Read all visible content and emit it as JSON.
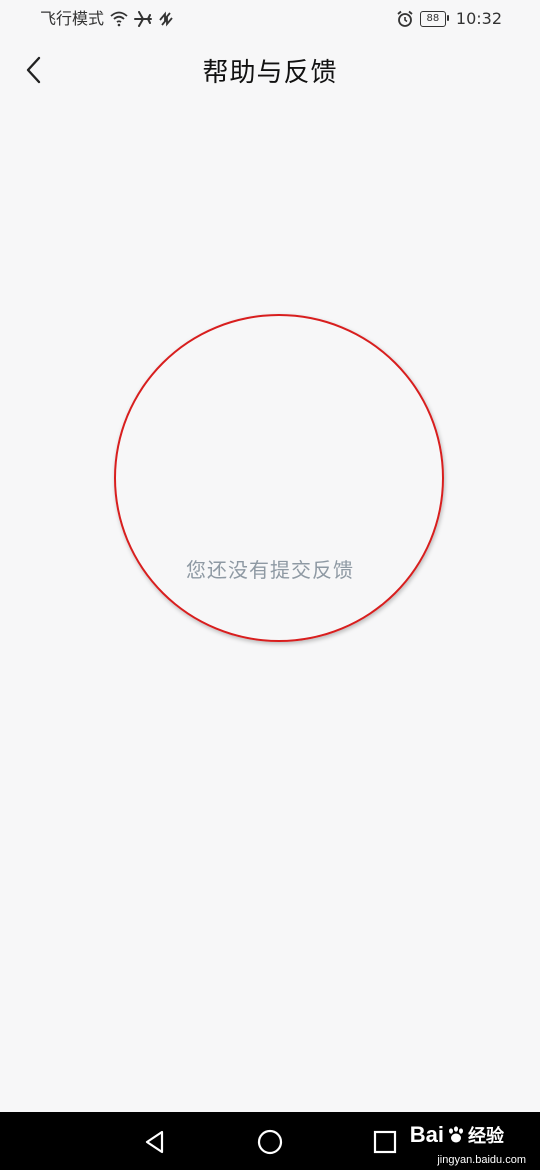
{
  "status_bar": {
    "carrier_text": "飞行模式",
    "battery_level": "88",
    "time": "10:32",
    "icons": [
      "wifi-icon",
      "airplane-icon",
      "data-off-icon",
      "alarm-icon",
      "battery-icon"
    ]
  },
  "nav": {
    "title": "帮助与反馈",
    "back_icon": "chevron-left-icon"
  },
  "main": {
    "empty_message": "您还没有提交反馈"
  },
  "annotation": {
    "circle_color": "#d81e1e"
  },
  "system_nav": {
    "buttons": [
      "back-triangle-icon",
      "home-circle-icon",
      "recents-square-icon"
    ]
  },
  "watermark": {
    "brand": "Bai 经验",
    "brand_prefix": "Bai",
    "brand_suffix": "经验",
    "url": "jingyan.baidu.com"
  }
}
